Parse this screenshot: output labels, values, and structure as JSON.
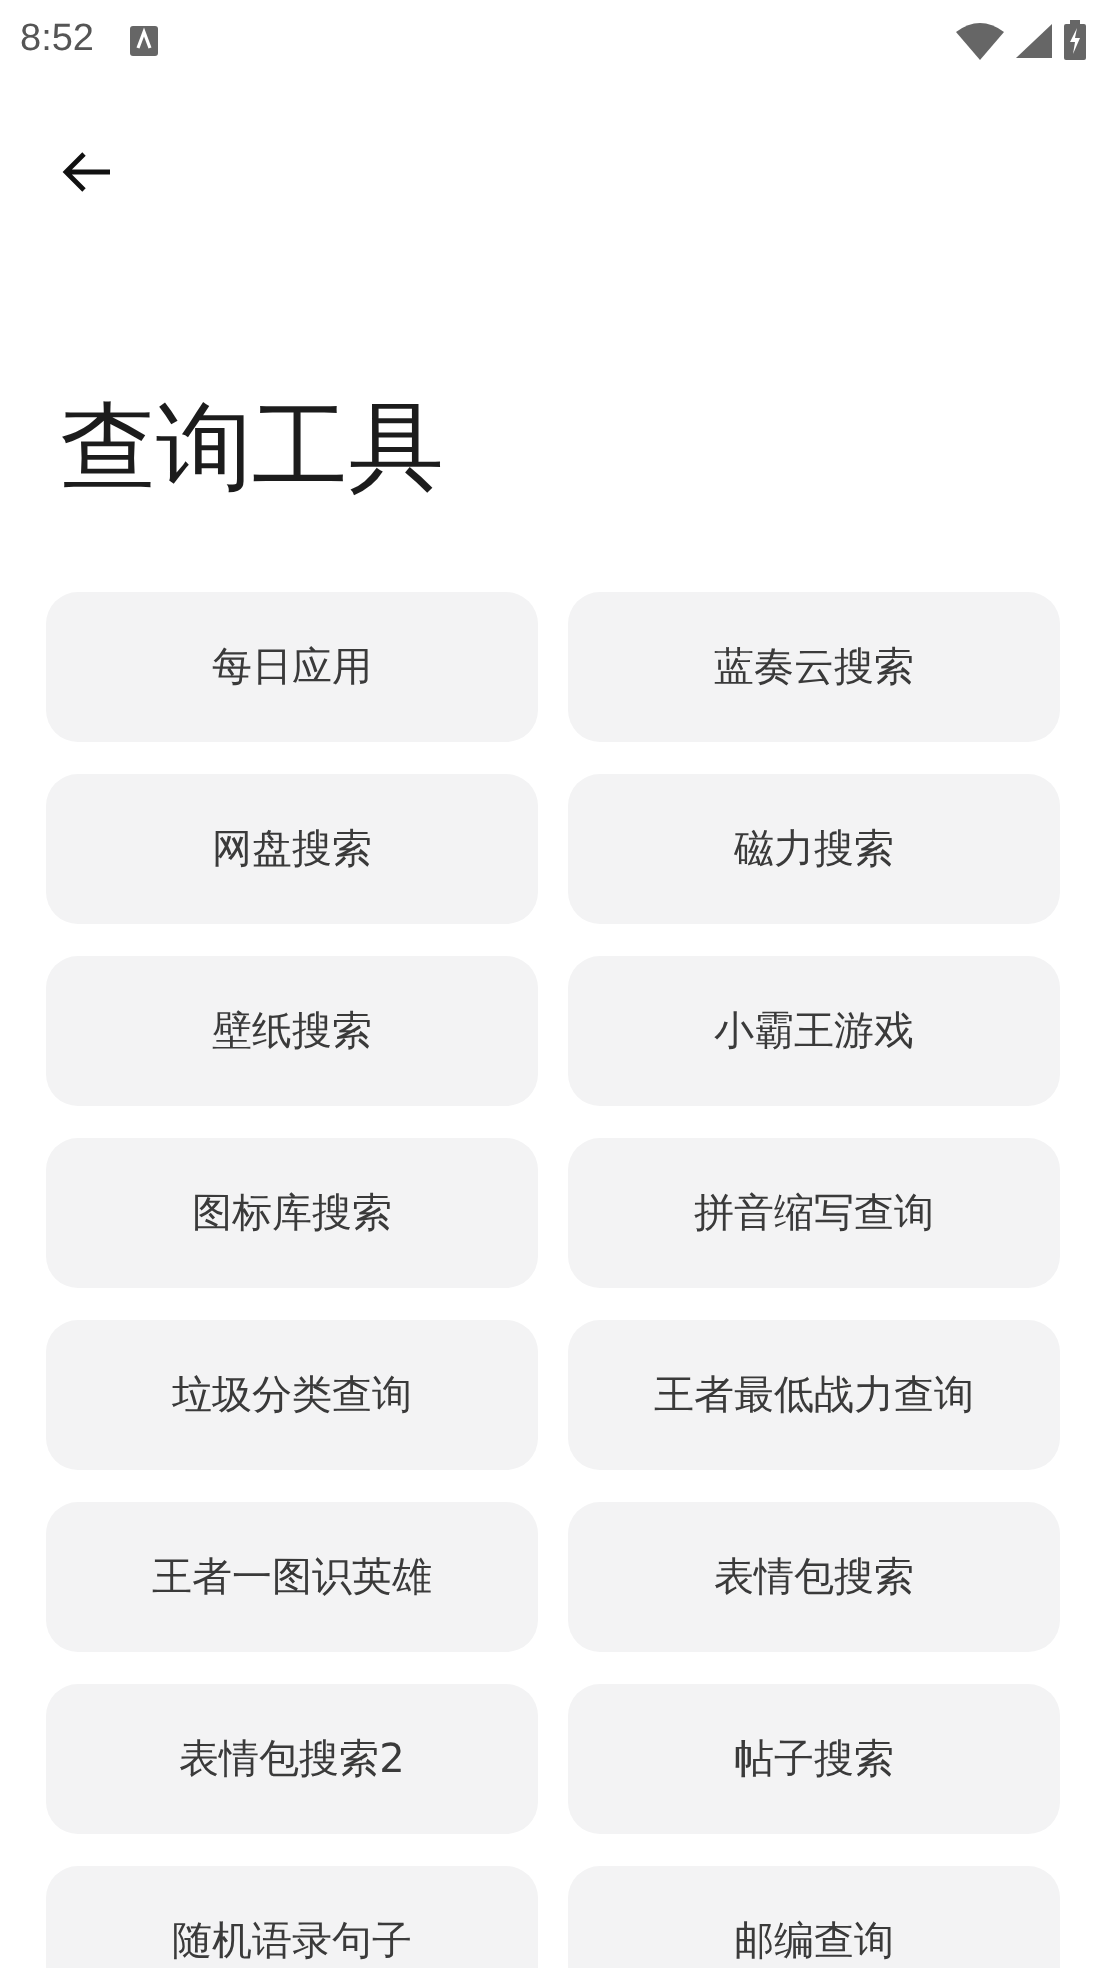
{
  "status_bar": {
    "time": "8:52"
  },
  "title": "查询工具",
  "tools": [
    {
      "label": "每日应用"
    },
    {
      "label": "蓝奏云搜索"
    },
    {
      "label": "网盘搜索"
    },
    {
      "label": "磁力搜索"
    },
    {
      "label": "壁纸搜索"
    },
    {
      "label": "小霸王游戏"
    },
    {
      "label": "图标库搜索"
    },
    {
      "label": "拼音缩写查询"
    },
    {
      "label": "垃圾分类查询"
    },
    {
      "label": "王者最低战力查询"
    },
    {
      "label": "王者一图识英雄"
    },
    {
      "label": "表情包搜索"
    },
    {
      "label": "表情包搜索2"
    },
    {
      "label": "帖子搜索"
    },
    {
      "label": "随机语录句子"
    },
    {
      "label": "邮编查询"
    }
  ]
}
